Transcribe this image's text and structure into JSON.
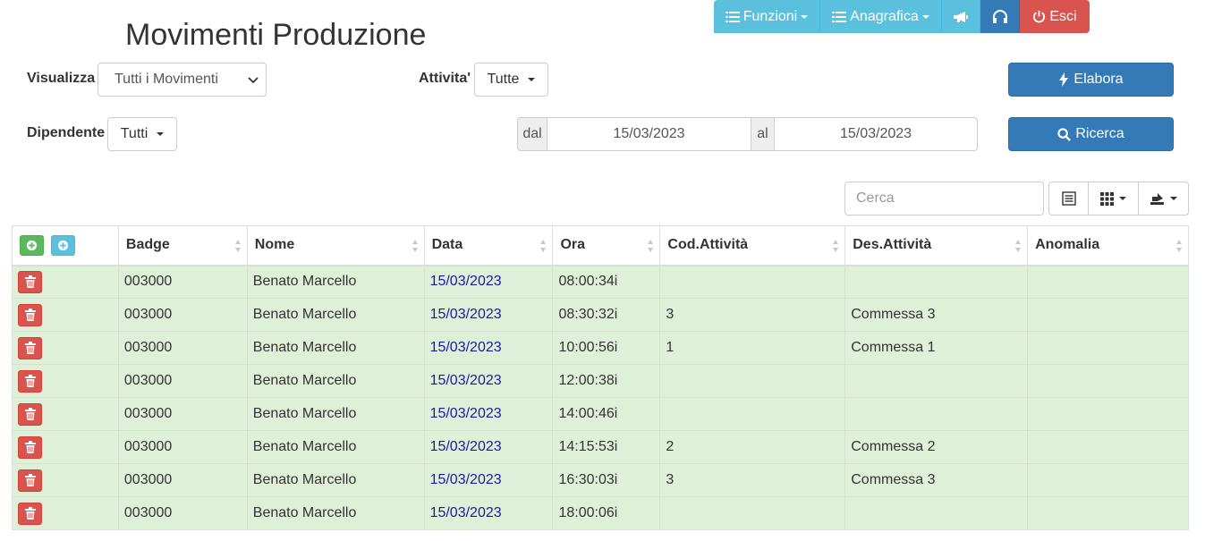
{
  "toolbar": {
    "funzioni_label": "Funzioni",
    "anagrafica_label": "Anagrafica",
    "esci_label": "Esci"
  },
  "page_title": "Movimenti Produzione",
  "filters": {
    "visualizza_label": "Visualizza",
    "visualizza_value": "Tutti i Movimenti",
    "attivita_label": "Attivita'",
    "attivita_value": "Tutte",
    "dipendente_label": "Dipendente",
    "dipendente_value": "Tutti",
    "dal_label": "dal",
    "dal_value": "15/03/2023",
    "al_label": "al",
    "al_value": "15/03/2023"
  },
  "actions": {
    "elabora_label": "Elabora",
    "ricerca_label": "Ricerca"
  },
  "search": {
    "placeholder": "Cerca"
  },
  "table": {
    "headers": [
      "Badge",
      "Nome",
      "Data",
      "Ora",
      "Cod.Attività",
      "Des.Attività",
      "Anomalia"
    ],
    "rows": [
      {
        "badge": "003000",
        "nome": "Benato Marcello",
        "data": "15/03/2023",
        "ora": "08:00:34i",
        "cod": "",
        "des": "",
        "anomalia": ""
      },
      {
        "badge": "003000",
        "nome": "Benato Marcello",
        "data": "15/03/2023",
        "ora": "08:30:32i",
        "cod": "3",
        "des": "Commessa 3",
        "anomalia": ""
      },
      {
        "badge": "003000",
        "nome": "Benato Marcello",
        "data": "15/03/2023",
        "ora": "10:00:56i",
        "cod": "1",
        "des": "Commessa 1",
        "anomalia": ""
      },
      {
        "badge": "003000",
        "nome": "Benato Marcello",
        "data": "15/03/2023",
        "ora": "12:00:38i",
        "cod": "",
        "des": "",
        "anomalia": ""
      },
      {
        "badge": "003000",
        "nome": "Benato Marcello",
        "data": "15/03/2023",
        "ora": "14:00:46i",
        "cod": "",
        "des": "",
        "anomalia": ""
      },
      {
        "badge": "003000",
        "nome": "Benato Marcello",
        "data": "15/03/2023",
        "ora": "14:15:53i",
        "cod": "2",
        "des": "Commessa 2",
        "anomalia": ""
      },
      {
        "badge": "003000",
        "nome": "Benato Marcello",
        "data": "15/03/2023",
        "ora": "16:30:03i",
        "cod": "3",
        "des": "Commessa 3",
        "anomalia": ""
      },
      {
        "badge": "003000",
        "nome": "Benato Marcello",
        "data": "15/03/2023",
        "ora": "18:00:06i",
        "cod": "",
        "des": "",
        "anomalia": ""
      }
    ]
  },
  "colors": {
    "info": "#5bc0de",
    "primary": "#337ab7",
    "danger": "#d9534f",
    "success": "#5cb85c",
    "row_bg": "#dff0d8",
    "date_link": "#1a1aa6"
  },
  "icons": {
    "funzioni": "list-icon",
    "anagrafica": "list-icon",
    "announce": "megaphone-icon",
    "support": "headphones-icon",
    "esci": "power-icon",
    "elabora": "bolt-icon",
    "ricerca": "search-icon",
    "delete": "trash-icon",
    "add": "plus-circle-icon",
    "view_list": "list-view-icon",
    "columns": "grid-icon",
    "export": "export-icon"
  }
}
